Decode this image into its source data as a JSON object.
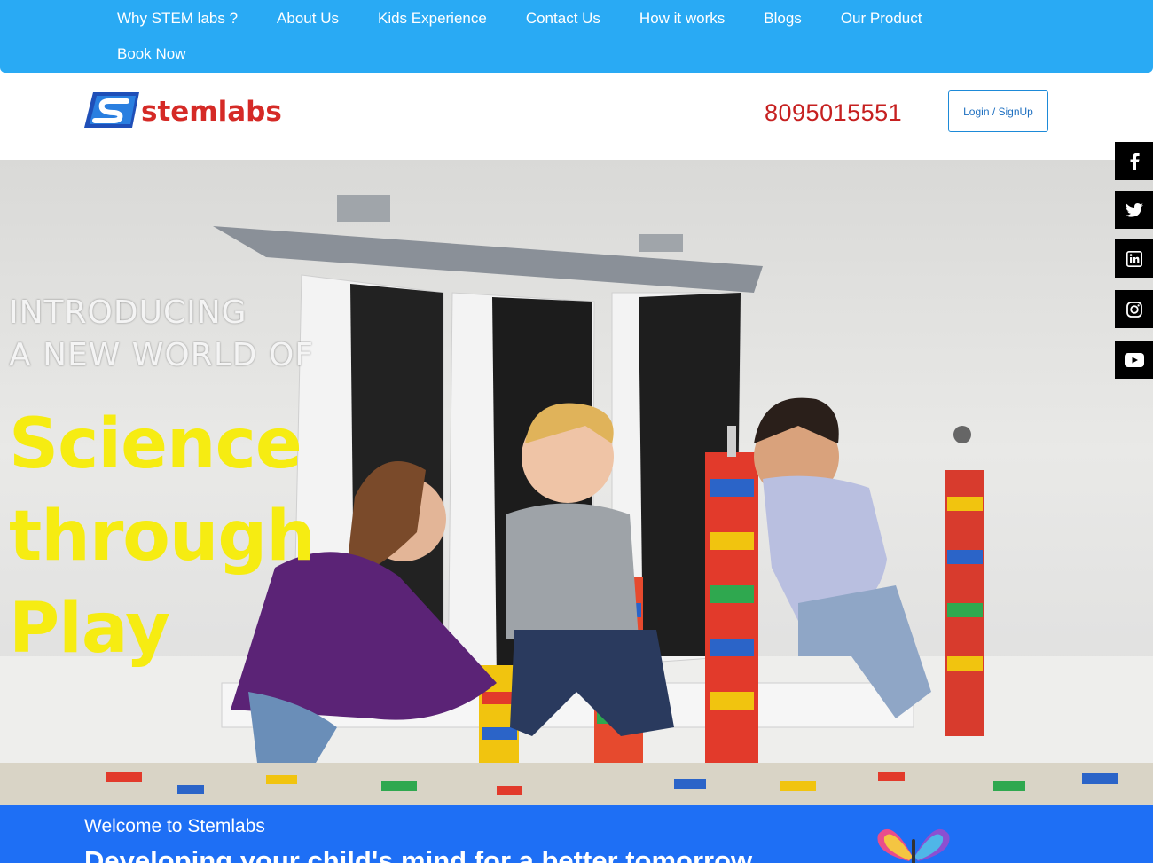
{
  "nav": {
    "row1": [
      "Why STEM labs ?",
      "About Us",
      "Kids Experience",
      "Contact Us",
      "How it works",
      "Blogs",
      "Our Product"
    ],
    "row2": [
      "Book Now"
    ]
  },
  "header": {
    "logo_text": "stemlabs",
    "phone": "8095015551",
    "login_label": "Login / SignUp"
  },
  "hero": {
    "intro_line1": "INTRODUCING",
    "intro_line2": "A NEW WORLD OF",
    "headline": [
      "Science",
      "through",
      "Play"
    ]
  },
  "social": [
    "facebook-icon",
    "twitter-icon",
    "linkedin-icon",
    "instagram-icon",
    "youtube-icon"
  ],
  "welcome": {
    "title": "Welcome to Stemlabs",
    "subtitle": "Developing your child's mind for a better tomorrow"
  },
  "colors": {
    "nav_bg": "#29aaf4",
    "phone": "#c62020",
    "headline_yellow": "#f6ec12",
    "welcome_bg": "#1e6ff5"
  }
}
